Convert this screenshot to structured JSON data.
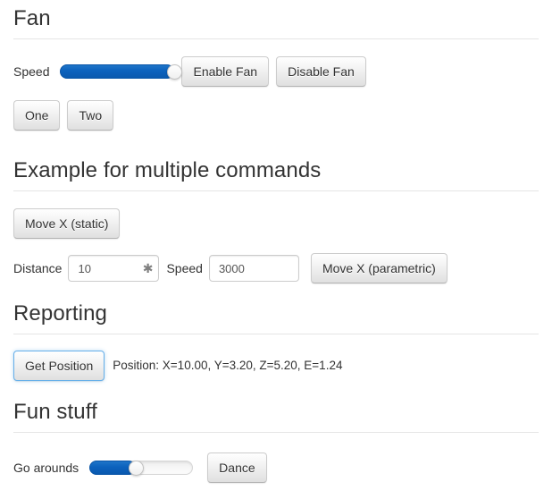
{
  "sections": [
    {
      "id": "fan",
      "title": "Fan",
      "speed_label": "Speed",
      "speed_slider": {
        "name": "fan-speed-slider",
        "value": 100,
        "min": 0,
        "max": 100
      },
      "enable_label": "Enable Fan",
      "disable_label": "Disable Fan",
      "one_label": "One",
      "two_label": "Two"
    },
    {
      "id": "multiple-commands",
      "title": "Example for multiple commands",
      "move_static_label": "Move X (static)",
      "distance_label": "Distance",
      "distance_value": "10",
      "distance_placeholder": "",
      "distance_spin_icon": "asterisk-icon",
      "distance_spin_glyph": "✱",
      "speed_label": "Speed",
      "speed_value": "3000",
      "speed_placeholder": "",
      "move_parametric_label": "Move X (parametric)"
    },
    {
      "id": "reporting",
      "title": "Reporting",
      "get_position_label": "Get Position",
      "position_text": "Position: X=10.00, Y=3.20, Z=5.20, E=1.24"
    },
    {
      "id": "fun-stuff",
      "title": "Fun stuff",
      "go_arounds_label": "Go arounds",
      "go_arounds_slider": {
        "name": "go-arounds-slider",
        "value": 45,
        "min": 0,
        "max": 100
      },
      "dance_label": "Dance"
    }
  ],
  "colors": {
    "accent_blue": "#0c62bd",
    "focus_blue": "#66afe9",
    "text": "#333333",
    "rule": "#e5e5e5",
    "input_border": "#cccccc",
    "button_border": "#cccccc"
  }
}
